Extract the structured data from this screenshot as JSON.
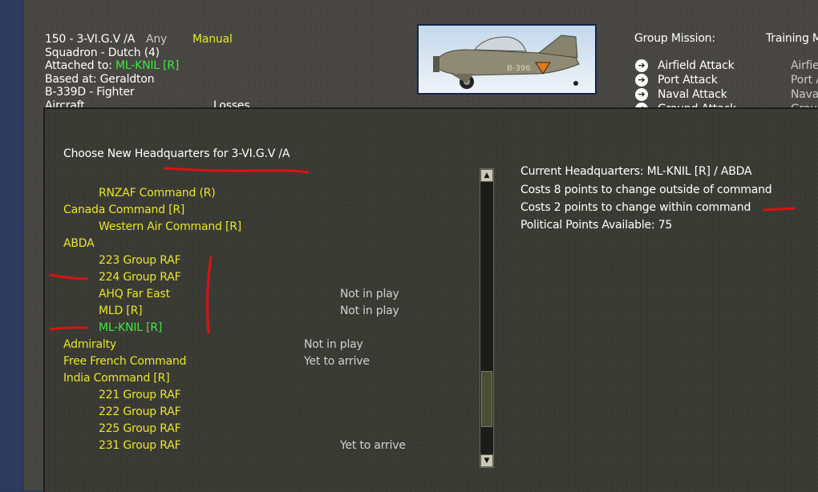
{
  "unit_panel": {
    "unit_line": "150 - 3-VI.G.V /A",
    "any": "Any",
    "manual": "Manual",
    "squadron": "Squadron - Dutch (4)",
    "attached_label": "Attached to:",
    "attached_value": "ML-KNIL [R]",
    "based_at": "Based at:  Geraldton",
    "aircraft_type": "B-339D - Fighter",
    "aircraft_header": "Aircraft",
    "losses_header": "Losses",
    "plane_marking": "B-396"
  },
  "missions": {
    "group_mission_label": "Group Mission:",
    "training_label": "Training M",
    "items": [
      "Airfield Attack",
      "Port Attack",
      "Naval Attack",
      "Ground Attack"
    ],
    "right_items": [
      "Airfie",
      "Port A",
      "Nava",
      "Grou"
    ]
  },
  "dialog": {
    "title": "Choose New Headquarters for 3-VI.G.V /A",
    "info": {
      "current_hq": "Current Headquarters: ML-KNIL  [R] / ABDA",
      "cost_outside": "Costs 8 points to change outside of command",
      "cost_within": "Costs 2 points to change within command",
      "political_points": "Political Points Available:  75"
    },
    "hq_list": [
      {
        "name": "RNZAF Command  (R)",
        "indent": true,
        "status": "",
        "color": "yellow"
      },
      {
        "name": "Canada Command [R]",
        "indent": false,
        "status": "",
        "color": "yellow"
      },
      {
        "name": "Western Air Command [R]",
        "indent": true,
        "status": "",
        "color": "yellow"
      },
      {
        "name": "ABDA",
        "indent": false,
        "status": "",
        "color": "yellow"
      },
      {
        "name": "223 Group RAF",
        "indent": true,
        "status": "",
        "color": "yellow"
      },
      {
        "name": "224 Group RAF",
        "indent": true,
        "status": "",
        "color": "yellow"
      },
      {
        "name": "AHQ Far East",
        "indent": true,
        "status": "Not in play",
        "color": "yellow"
      },
      {
        "name": "MLD [R]",
        "indent": true,
        "status": "Not in play",
        "color": "yellow"
      },
      {
        "name": "ML-KNIL  [R]",
        "indent": true,
        "status": "",
        "color": "green"
      },
      {
        "name": "Admiralty",
        "indent": false,
        "status": "Not in play",
        "color": "yellow"
      },
      {
        "name": "Free French Command",
        "indent": false,
        "status": "Yet to arrive",
        "color": "yellow"
      },
      {
        "name": "India Command [R]",
        "indent": false,
        "status": "",
        "color": "yellow"
      },
      {
        "name": "221 Group RAF",
        "indent": true,
        "status": "",
        "color": "yellow"
      },
      {
        "name": "222 Group RAF",
        "indent": true,
        "status": "",
        "color": "yellow"
      },
      {
        "name": "225 Group RAF",
        "indent": true,
        "status": "",
        "color": "yellow"
      },
      {
        "name": "231 Group RAF",
        "indent": true,
        "status": "Yet to arrive",
        "color": "yellow"
      }
    ]
  },
  "colors": {
    "yellow_text": "#e6e62a",
    "green_text": "#3ee83e",
    "annotation_red": "#e01010"
  }
}
